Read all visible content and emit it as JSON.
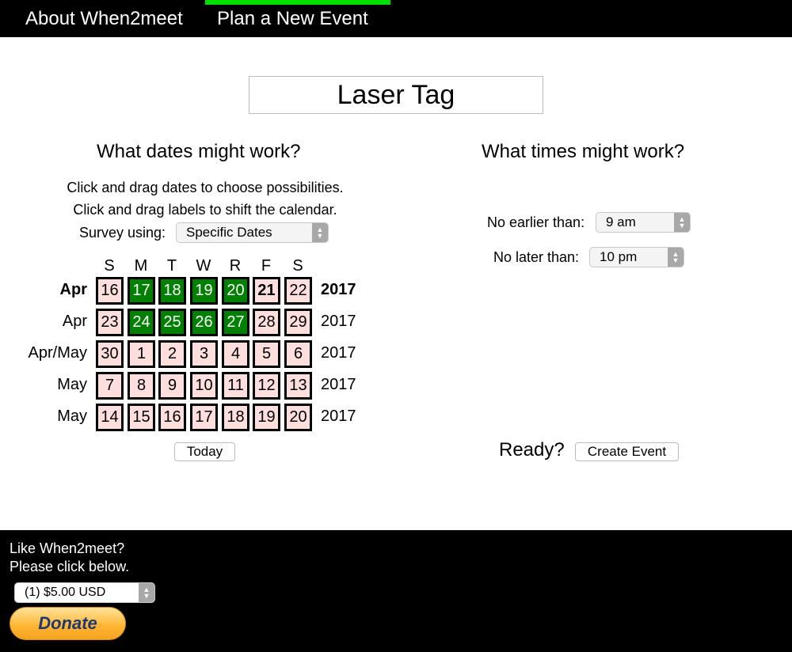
{
  "nav": {
    "about": "About When2meet",
    "plan": "Plan a New Event"
  },
  "event": {
    "name": "Laser Tag"
  },
  "dates": {
    "heading": "What dates might work?",
    "instruction1": "Click and drag dates to choose possibilities.",
    "instruction2": "Click and drag labels to shift the calendar.",
    "survey_label": "Survey using:",
    "survey_value": "Specific Dates",
    "weekdays": [
      "S",
      "M",
      "T",
      "W",
      "R",
      "F",
      "S"
    ],
    "rows": [
      {
        "month": "Apr",
        "year": "2017",
        "bold": true,
        "days": [
          "16",
          "17",
          "18",
          "19",
          "20",
          "21",
          "22"
        ],
        "selected": [
          false,
          true,
          true,
          true,
          true,
          false,
          false
        ],
        "today": [
          false,
          false,
          false,
          false,
          false,
          true,
          false
        ]
      },
      {
        "month": "Apr",
        "year": "2017",
        "bold": false,
        "days": [
          "23",
          "24",
          "25",
          "26",
          "27",
          "28",
          "29"
        ],
        "selected": [
          false,
          true,
          true,
          true,
          true,
          false,
          false
        ],
        "today": [
          false,
          false,
          false,
          false,
          false,
          false,
          false
        ]
      },
      {
        "month": "Apr/May",
        "year": "2017",
        "bold": false,
        "days": [
          "30",
          "1",
          "2",
          "3",
          "4",
          "5",
          "6"
        ],
        "selected": [
          false,
          false,
          false,
          false,
          false,
          false,
          false
        ],
        "today": [
          false,
          false,
          false,
          false,
          false,
          false,
          false
        ]
      },
      {
        "month": "May",
        "year": "2017",
        "bold": false,
        "days": [
          "7",
          "8",
          "9",
          "10",
          "11",
          "12",
          "13"
        ],
        "selected": [
          false,
          false,
          false,
          false,
          false,
          false,
          false
        ],
        "today": [
          false,
          false,
          false,
          false,
          false,
          false,
          false
        ]
      },
      {
        "month": "May",
        "year": "2017",
        "bold": false,
        "days": [
          "14",
          "15",
          "16",
          "17",
          "18",
          "19",
          "20"
        ],
        "selected": [
          false,
          false,
          false,
          false,
          false,
          false,
          false
        ],
        "today": [
          false,
          false,
          false,
          false,
          false,
          false,
          false
        ]
      }
    ],
    "today_button": "Today"
  },
  "times": {
    "heading": "What times might work?",
    "earliest_label": "No earlier than:",
    "earliest_value": "9 am",
    "latest_label": "No later than:",
    "latest_value": "10 pm"
  },
  "ready": {
    "label": "Ready?",
    "create_button": "Create Event"
  },
  "footer": {
    "line1": "Like When2meet?",
    "line2": "Please click below.",
    "donation_option": "(1) $5.00 USD",
    "donate_button": "Donate"
  },
  "colors": {
    "selected_date": "#008000",
    "unselected_date": "#ffdede",
    "nav_active": "#00e000"
  }
}
